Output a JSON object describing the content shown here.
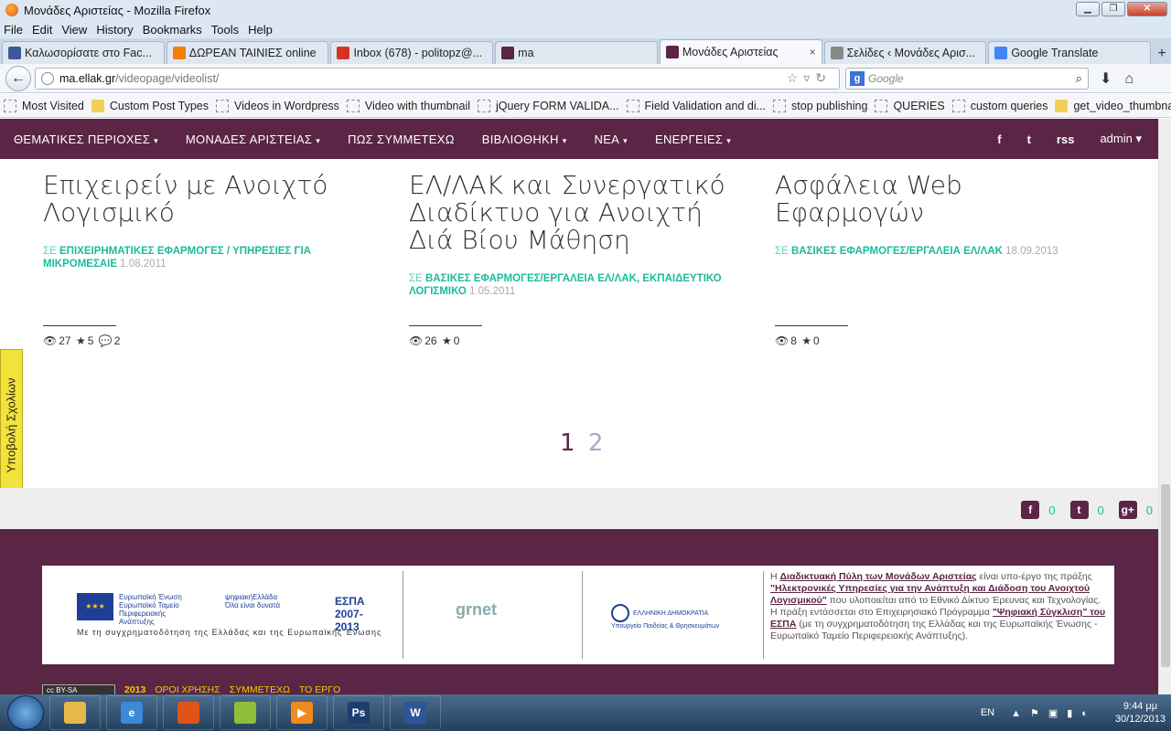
{
  "window": {
    "title": "Μονάδες Αριστείας - Mozilla Firefox",
    "controls": [
      "▁",
      "❐",
      "✕"
    ]
  },
  "menu": [
    "File",
    "Edit",
    "View",
    "History",
    "Bookmarks",
    "Tools",
    "Help"
  ],
  "tabs": [
    {
      "label": "Καλωσορίσατε στο Fac...",
      "icon_color": "#3b5998"
    },
    {
      "label": "ΔΩΡΕΑΝ ΤΑΙΝΙΕΣ online",
      "icon_color": "#f57d00"
    },
    {
      "label": "Inbox (678) - politopz@...",
      "icon_color": "#d93025"
    },
    {
      "label": "ma",
      "icon_color": "#5b2546"
    },
    {
      "label": "Μονάδες Αριστείας",
      "icon_color": "#5b2546",
      "active": true
    },
    {
      "label": "Σελίδες ‹ Μονάδες Αρισ...",
      "icon_color": "#888888"
    },
    {
      "label": "Google Translate",
      "icon_color": "#4285f4"
    }
  ],
  "tab_close": "×",
  "tab_add": "+",
  "url": {
    "domain": "ma.ellak.gr",
    "path": "/videopage/videolist/"
  },
  "search": {
    "placeholder": "Google"
  },
  "bookmarks": [
    {
      "label": "Most Visited",
      "folder": false
    },
    {
      "label": "Custom Post Types",
      "folder": true
    },
    {
      "label": "Videos in Wordpress",
      "folder": false
    },
    {
      "label": "Video with thumbnail",
      "folder": false
    },
    {
      "label": "jQuery FORM VALIDA...",
      "folder": false
    },
    {
      "label": "Field Validation and di...",
      "folder": false
    },
    {
      "label": "stop publishing",
      "folder": false
    },
    {
      "label": "QUERIES",
      "folder": false
    },
    {
      "label": "custom queries",
      "folder": false
    },
    {
      "label": "get_video_thumbnails",
      "folder": true
    }
  ],
  "site_nav": {
    "items": [
      {
        "label": "ΘΕΜΑΤΙΚΕΣ ΠΕΡΙΟΧΕΣ",
        "caret": "▾"
      },
      {
        "label": "ΜΟΝΑΔΕΣ ΑΡΙΣΤΕΙΑΣ",
        "caret": "▾"
      },
      {
        "label": "ΠΩΣ ΣΥΜΜΕΤΕΧΩ",
        "caret": ""
      },
      {
        "label": "ΒΙΒΛΙΟΘΗΚΗ",
        "caret": "▾"
      },
      {
        "label": "ΝΕΑ",
        "caret": "▾"
      },
      {
        "label": "ΕΝΕΡΓΕΙΕΣ",
        "caret": "▾"
      }
    ],
    "social": [
      "f",
      "t",
      "rss"
    ],
    "user": "admin ▾"
  },
  "cards": [
    {
      "title": "Επιχειρείν με Ανοιχτό Λογισμικό",
      "se": "ΣΕ",
      "category": "ΕΠΙΧΕΙΡΗΜΑΤΙΚΕΣ ΕΦΑΡΜΟΓΕΣ / ΥΠΗΡΕΣΙΕΣ ΓΙΑ ΜΙΚΡΟΜΕΣΑΙΕ",
      "date": "1.08.2011",
      "views": "27",
      "stars": "5",
      "comments": "2"
    },
    {
      "title": "ΕΛ/ΛΑΚ και Συνεργατικό Διαδίκτυο για Ανοιχτή Διά Βίου Μάθηση",
      "se": "ΣΕ",
      "category": "ΒΑΣΙΚΕΣ ΕΦΑΡΜΟΓΕΣ/ΕΡΓΑΛΕΙΑ ΕΛ/ΛΑΚ, ΕΚΠΑΙΔΕΥΤΙΚΟ ΛΟΓΙΣΜΙΚΟ",
      "date": "1.05.2011",
      "views": "26",
      "stars": "0",
      "comments": ""
    },
    {
      "title": "Ασφάλεια Web Εφαρμογών",
      "se": "ΣΕ",
      "category": "ΒΑΣΙΚΕΣ ΕΦΑΡΜΟΓΕΣ/ΕΡΓΑΛΕΙΑ ΕΛ/ΛΑΚ",
      "date": "18.09.2013",
      "views": "8",
      "stars": "0",
      "comments": ""
    }
  ],
  "pagination": {
    "current": "1",
    "next": "2"
  },
  "side_tab": "Υποβολή Σχολίων",
  "shares": [
    {
      "icon": "f",
      "count": "0"
    },
    {
      "icon": "t",
      "count": "0"
    },
    {
      "icon": "g+",
      "count": "0"
    }
  ],
  "footer": {
    "eu_text": "Ευρωπαϊκή Ένωση\nΕυρωπαϊκό Ταμείο Περιφερειακής Ανάπτυξης",
    "digital_text": "ψηφιακήΕλλάδα\nΌλα είναι δυνατά",
    "espa": "ΕΣΠΑ\n2007-2013",
    "caption": "Με τη συγχρηματοδότηση της Ελλάδας και της Ευρωπαϊκής Ένωσης",
    "grnet": "grnet",
    "ministry": "ΕΛΛΗΝΙΚΗ ΔΗΜΟΚΡΑΤΙΑ Υπουργείο Παιδείας & Θρησκευμάτων",
    "text_prefix": "Η ",
    "text_link1": "Διαδικτυακή Πύλη των Μονάδων Αριστείας",
    "text_mid1": " είναι υπο-έργο της πράξης ",
    "text_link2": "\"Ηλεκτρονικές Υπηρεσίες για την Ανάπτυξη και Διάδοση του Ανοιχτού Λογισμικού\"",
    "text_mid2": " που υλοποιείται από το Εθνικό Δίκτυο Έρευνας και Τεχνολογίας. Η πράξη εντάσσεται στο Επιχειρησιακό Πρόγραμμα ",
    "text_link3": "\"Ψηφιακή Σύγκλιση\" του ΕΣΠΑ",
    "text_suffix": " (με τη συγχρηματοδότηση της Ελλάδας και της Ευρωπαϊκής Ένωσης - Ευρωπαϊκό Ταμείο Περιφερειακής Ανάπτυξης).",
    "cc": "cc BY-SA",
    "year": "2013",
    "links": [
      "ΟΡΟΙ ΧΡΗΣΗΣ",
      "ΣΥΜΜΕΤΕΧΩ",
      "ΤΟ ΕΡΓΟ"
    ]
  },
  "taskbar": {
    "apps": [
      {
        "name": "explorer",
        "color": "#e6b84a",
        "glyph": ""
      },
      {
        "name": "ie",
        "color": "#3a8ad8",
        "glyph": "e"
      },
      {
        "name": "firefox",
        "color": "#e0541a",
        "glyph": ""
      },
      {
        "name": "notepad",
        "color": "#8fbf3a",
        "glyph": ""
      },
      {
        "name": "media",
        "color": "#f08a1e",
        "glyph": "▶"
      },
      {
        "name": "photoshop",
        "color": "#1c3e6e",
        "glyph": "Ps"
      },
      {
        "name": "word",
        "color": "#2b5797",
        "glyph": "W"
      }
    ],
    "lang": "EN",
    "time": "9:44 μμ",
    "date": "30/12/2013"
  }
}
